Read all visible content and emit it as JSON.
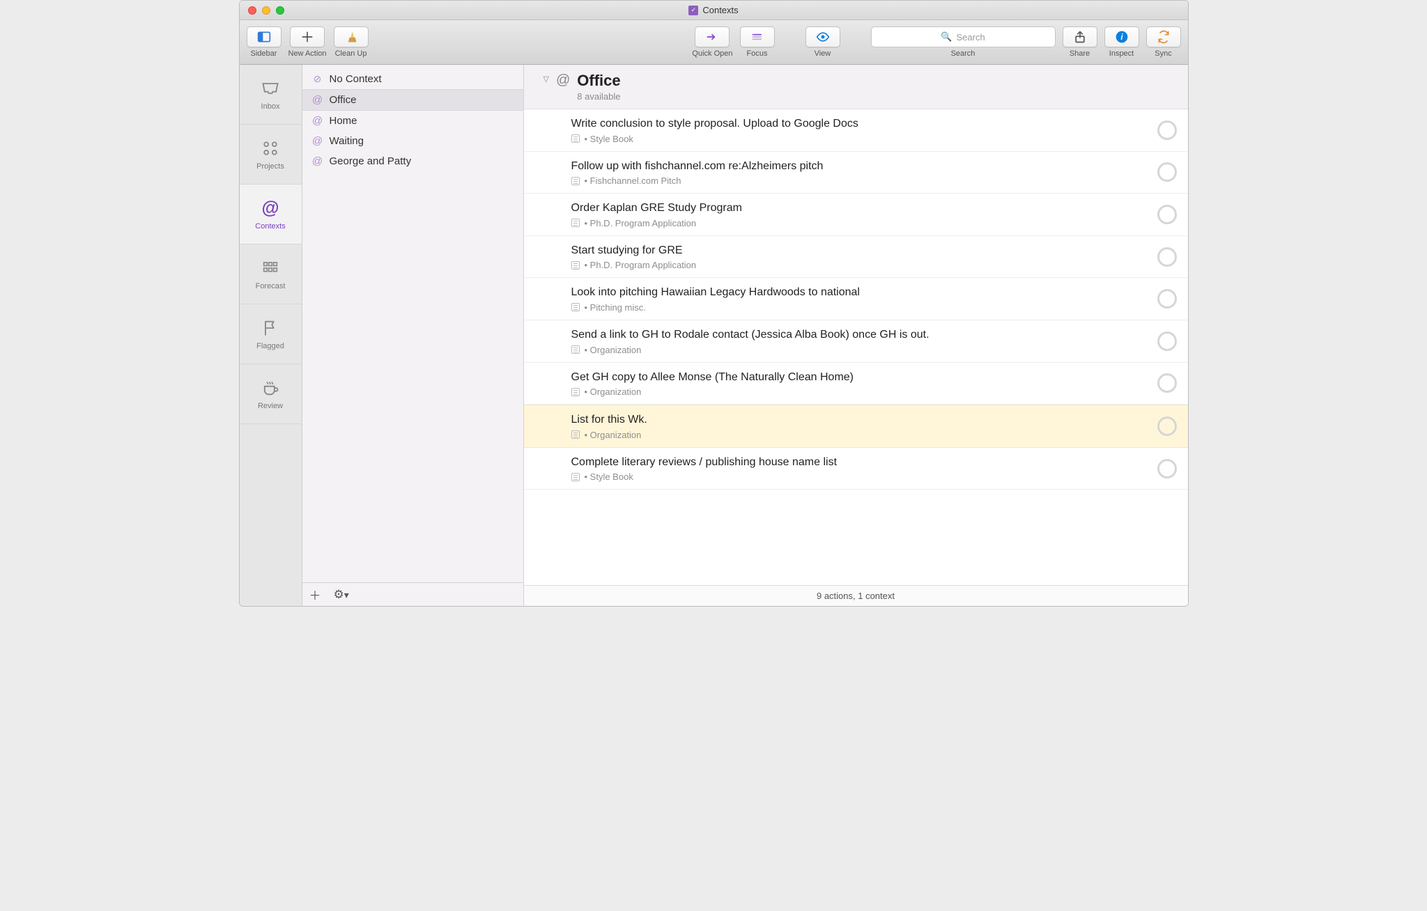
{
  "window": {
    "title": "Contexts"
  },
  "toolbar": {
    "sidebar": "Sidebar",
    "new_action": "New Action",
    "clean_up": "Clean Up",
    "quick_open": "Quick Open",
    "focus": "Focus",
    "view": "View",
    "share": "Share",
    "inspect": "Inspect",
    "sync": "Sync",
    "search_label": "Search",
    "search_placeholder": "Search"
  },
  "rail": {
    "inbox": "Inbox",
    "projects": "Projects",
    "contexts": "Contexts",
    "forecast": "Forecast",
    "flagged": "Flagged",
    "review": "Review"
  },
  "contexts_list": {
    "no_context": "No Context",
    "items": [
      {
        "label": "Office"
      },
      {
        "label": "Home"
      },
      {
        "label": "Waiting"
      },
      {
        "label": "George and Patty"
      }
    ]
  },
  "header": {
    "title": "Office",
    "subtitle": "8 available"
  },
  "tasks": [
    {
      "title": "Write conclusion to style proposal. Upload to Google Docs",
      "project": "Style Book",
      "highlight": false
    },
    {
      "title": "Follow up with fishchannel.com re:Alzheimers pitch",
      "project": "Fishchannel.com Pitch",
      "highlight": false
    },
    {
      "title": "Order Kaplan GRE Study Program",
      "project": "Ph.D. Program Application",
      "highlight": false
    },
    {
      "title": "Start studying for GRE",
      "project": "Ph.D. Program Application",
      "highlight": false
    },
    {
      "title": "Look into pitching Hawaiian Legacy Hardwoods to national",
      "project": "Pitching misc.",
      "highlight": false
    },
    {
      "title": "Send a link to GH to Rodale contact (Jessica Alba Book) once GH is out.",
      "project": "Organization",
      "highlight": false
    },
    {
      "title": "Get GH copy to Allee Monse (The Naturally Clean Home)",
      "project": "Organization",
      "highlight": false
    },
    {
      "title": "List for this Wk.",
      "project": "Organization",
      "highlight": true
    },
    {
      "title": "Complete literary reviews / publishing house name list",
      "project": "Style Book",
      "highlight": false
    }
  ],
  "status": "9 actions, 1 context"
}
